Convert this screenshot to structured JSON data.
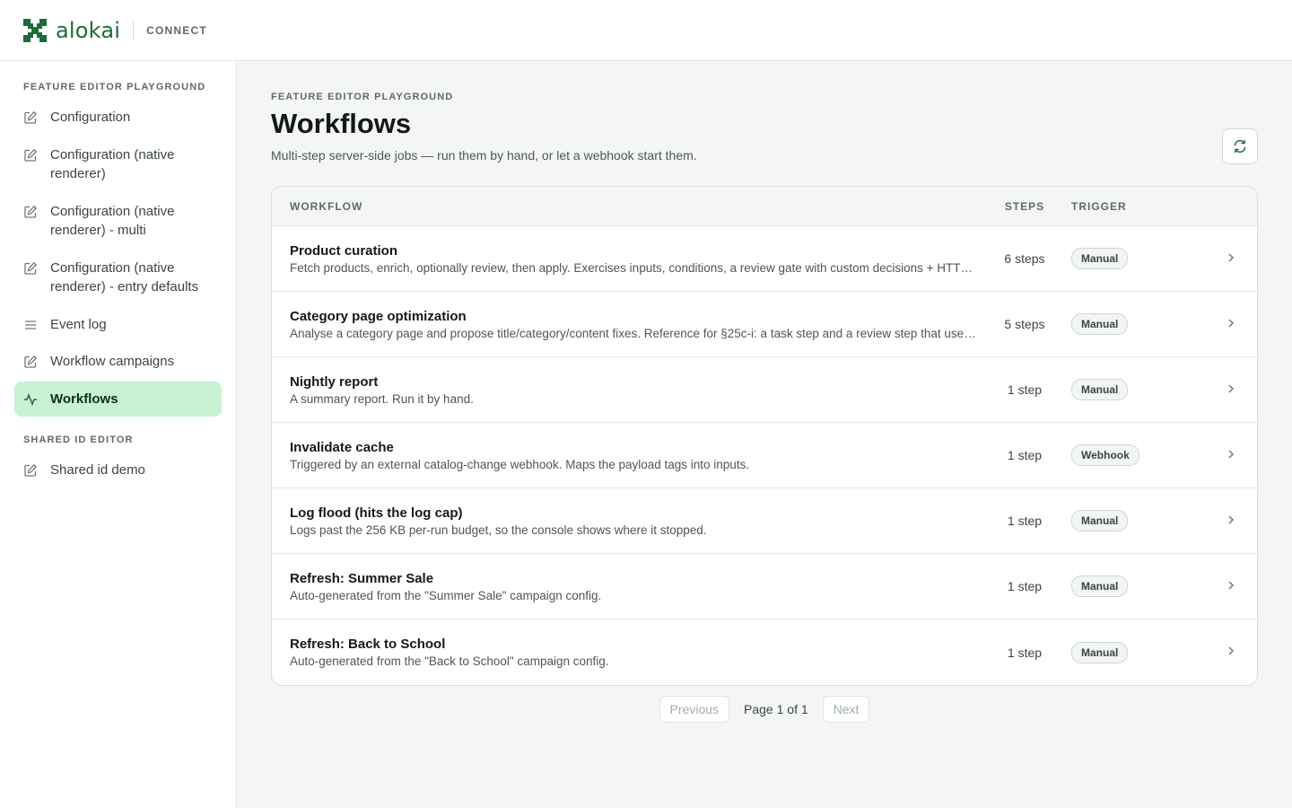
{
  "brand": {
    "name": "alokai",
    "product": "CONNECT",
    "color": "#1b6b3c"
  },
  "sidebar": {
    "sections": [
      {
        "label": "FEATURE EDITOR PLAYGROUND",
        "items": [
          {
            "label": "Configuration",
            "icon": "edit-icon"
          },
          {
            "label": "Configuration (native renderer)",
            "icon": "edit-icon"
          },
          {
            "label": "Configuration (native renderer) - multi",
            "icon": "edit-icon"
          },
          {
            "label": "Configuration (native renderer) - entry defaults",
            "icon": "edit-icon"
          },
          {
            "label": "Event log",
            "icon": "list-icon"
          },
          {
            "label": "Workflow campaigns",
            "icon": "edit-icon"
          },
          {
            "label": "Workflows",
            "icon": "activity-icon",
            "active": true
          }
        ]
      },
      {
        "label": "SHARED ID EDITOR",
        "items": [
          {
            "label": "Shared id demo",
            "icon": "edit-icon"
          }
        ]
      }
    ],
    "active_color": "#c8f2d3"
  },
  "main": {
    "eyebrow": "FEATURE EDITOR PLAYGROUND",
    "title": "Workflows",
    "subtitle": "Multi-step server-side jobs — run them by hand, or let a webhook start them.",
    "refresh_icon": "refresh-icon"
  },
  "table": {
    "headers": {
      "workflow": "WORKFLOW",
      "steps": "STEPS",
      "trigger": "TRIGGER"
    },
    "rows": [
      {
        "title": "Product curation",
        "desc": "Fetch products, enrich, optionally review, then apply. Exercises inputs, conditions, a review gate with custom decisions + HTTP fetch.",
        "steps": "6 steps",
        "trigger": "Manual"
      },
      {
        "title": "Category page optimization",
        "desc": "Analyse a category page and propose title/category/content fixes. Reference for §25c-i: a task step and a review step that use the same data.",
        "steps": "5 steps",
        "trigger": "Manual"
      },
      {
        "title": "Nightly report",
        "desc": "A summary report. Run it by hand.",
        "steps": "1 step",
        "trigger": "Manual"
      },
      {
        "title": "Invalidate cache",
        "desc": "Triggered by an external catalog-change webhook. Maps the payload tags into inputs.",
        "steps": "1 step",
        "trigger": "Webhook"
      },
      {
        "title": "Log flood (hits the log cap)",
        "desc": "Logs past the 256 KB per-run budget, so the console shows where it stopped.",
        "steps": "1 step",
        "trigger": "Manual"
      },
      {
        "title": "Refresh: Summer Sale",
        "desc": "Auto-generated from the \"Summer Sale\" campaign config.",
        "steps": "1 step",
        "trigger": "Manual"
      },
      {
        "title": "Refresh: Back to School",
        "desc": "Auto-generated from the \"Back to School\" campaign config.",
        "steps": "1 step",
        "trigger": "Manual"
      }
    ]
  },
  "pagination": {
    "previous": "Previous",
    "page_text": "Page 1 of 1",
    "next": "Next"
  }
}
